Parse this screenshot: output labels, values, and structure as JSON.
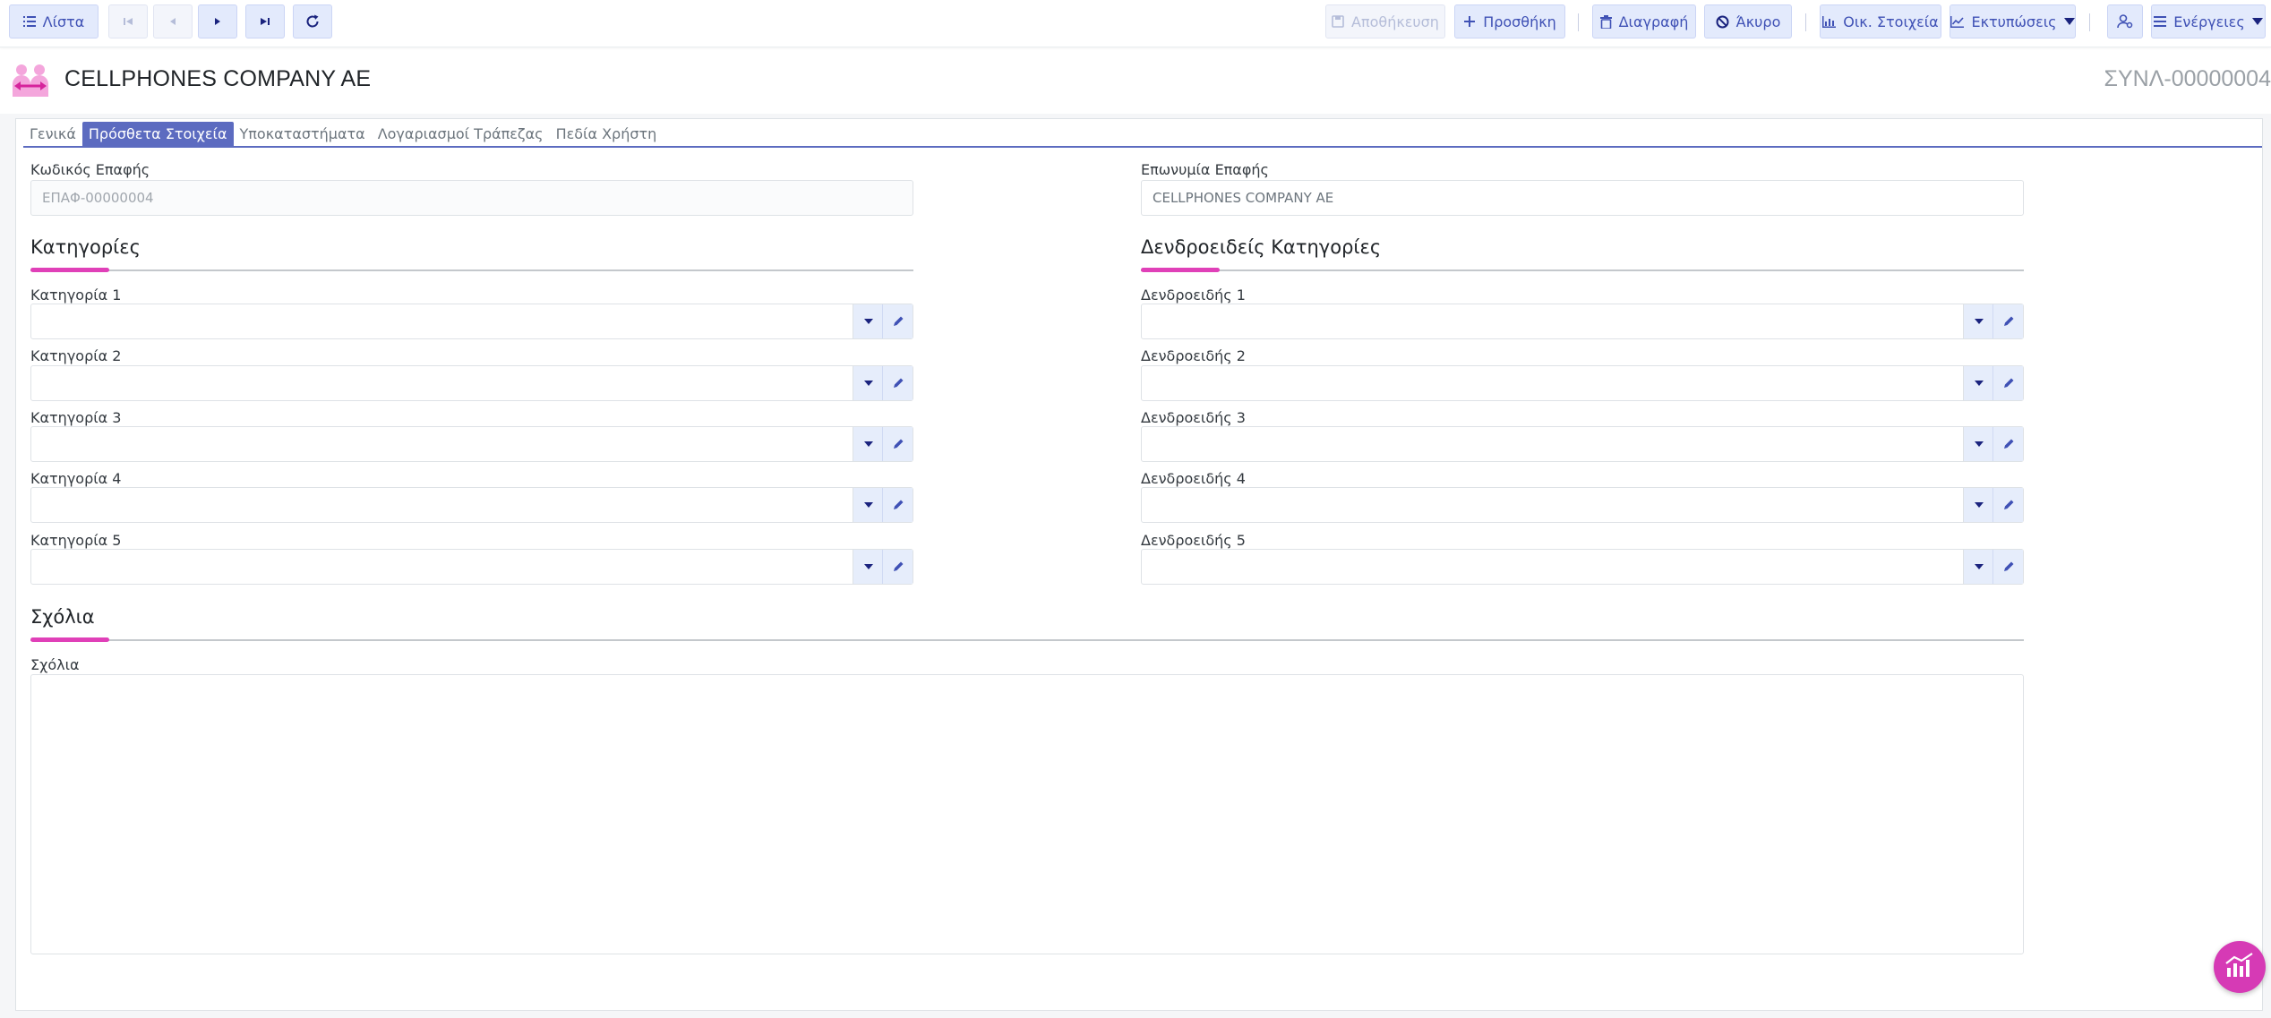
{
  "toolbar": {
    "list_label": "Λίστα",
    "save_label": "Αποθήκευση",
    "add_label": "Προσθήκη",
    "delete_label": "Διαγραφή",
    "cancel_label": "Άκυρο",
    "financial_label": "Οικ. Στοιχεία",
    "prints_label": "Εκτυπώσεις",
    "actions_label": "Ενέργειες"
  },
  "header": {
    "title": "CELLPHONES COMPANY AE",
    "code": "ΣΥΝΛ-00000004"
  },
  "tabs": [
    {
      "label": "Γενικά"
    },
    {
      "label": "Πρόσθετα Στοιχεία"
    },
    {
      "label": "Υποκαταστήματα"
    },
    {
      "label": "Λογαριασμοί Τράπεζας"
    },
    {
      "label": "Πεδία Χρήστη"
    }
  ],
  "active_tab": "Πρόσθετα Στοιχεία",
  "form": {
    "contact_code": {
      "label": "Κωδικός Επαφής",
      "value": "ΕΠΑΦ-00000004"
    },
    "contact_name": {
      "label": "Επωνυμία Επαφής",
      "value": "CELLPHONES COMPANY AE"
    },
    "categories": {
      "title": "Κατηγορίες",
      "items": [
        {
          "label": "Κατηγορία 1",
          "value": ""
        },
        {
          "label": "Κατηγορία 2",
          "value": ""
        },
        {
          "label": "Κατηγορία 3",
          "value": ""
        },
        {
          "label": "Κατηγορία 4",
          "value": ""
        },
        {
          "label": "Κατηγορία 5",
          "value": ""
        }
      ]
    },
    "tree_categories": {
      "title": "Δενδροειδείς Κατηγορίες",
      "items": [
        {
          "label": "Δενδροειδής 1",
          "value": ""
        },
        {
          "label": "Δενδροειδής 2",
          "value": ""
        },
        {
          "label": "Δενδροειδής 3",
          "value": ""
        },
        {
          "label": "Δενδροειδής 4",
          "value": ""
        },
        {
          "label": "Δενδροειδής 5",
          "value": ""
        }
      ]
    },
    "comments": {
      "title": "Σχόλια",
      "label": "Σχόλια",
      "value": ""
    }
  },
  "colors": {
    "accent": "#5c6bc0",
    "section_accent": "#e040b8",
    "button_bg": "#e3eafc",
    "fab": "#d63ab5"
  },
  "icons": [
    "list-icon",
    "first-record-icon",
    "previous-record-icon",
    "next-record-icon",
    "last-record-icon",
    "refresh-icon",
    "save-icon",
    "plus-icon",
    "trash-icon",
    "ban-icon",
    "chart-icon",
    "line-chart-icon",
    "caret-down-icon",
    "user-settings-icon",
    "menu-icon",
    "pencil-icon",
    "contacts-logo-icon",
    "analytics-icon"
  ]
}
